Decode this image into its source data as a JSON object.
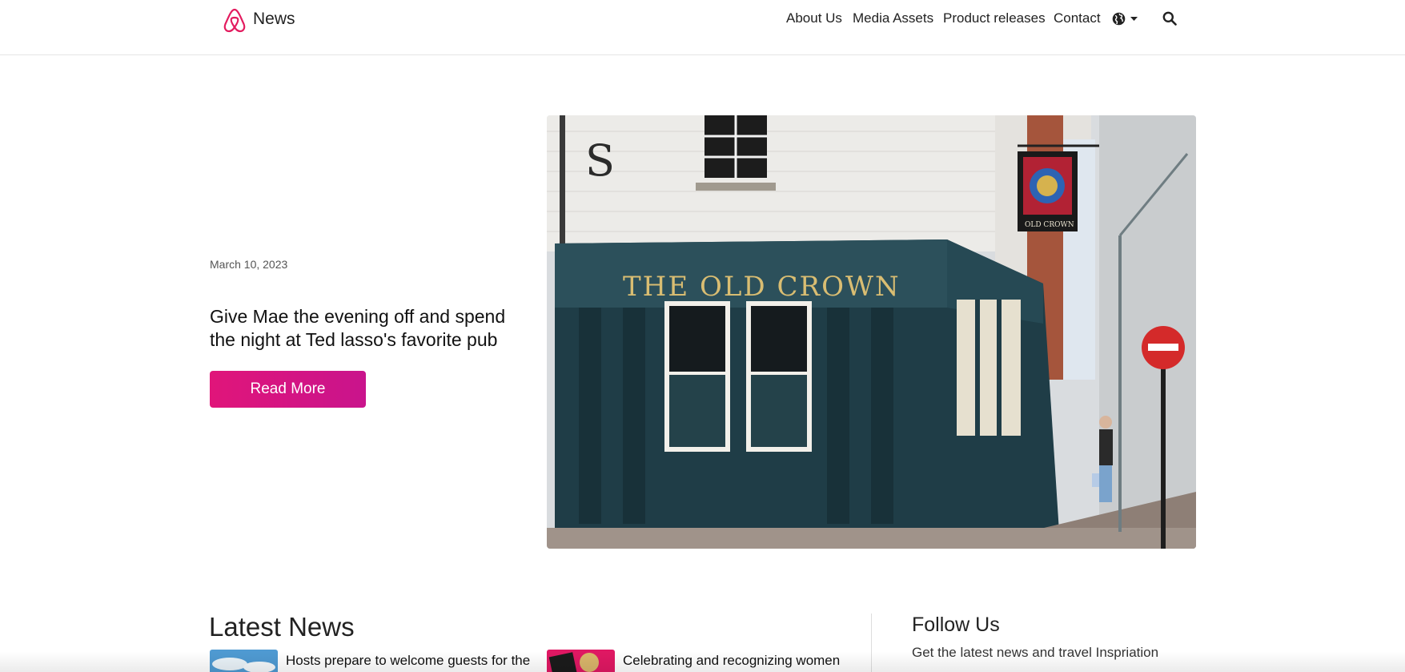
{
  "header": {
    "brand_text": "News",
    "nav": {
      "about": "About Us",
      "media": "Media Assets",
      "product": "Product releases",
      "contact": "Contact"
    },
    "icons": [
      "airbnb-logo-icon",
      "globe-icon",
      "caret-down-icon",
      "search-icon"
    ],
    "brand_color": "#e31c5f"
  },
  "hero": {
    "date": "March 10, 2023",
    "title": "Give Mae the evening off and spend the night at Ted lasso's favorite pub",
    "button_label": "Read More",
    "button_color": "#d8157f",
    "image_sign_text": "THE OLD CROWN",
    "image_hanging_sign_text": "OLD CROWN"
  },
  "latest": {
    "heading": "Latest News",
    "items": [
      {
        "title": "Hosts prepare to welcome guests for the"
      },
      {
        "title": "Celebrating and recognizing women"
      }
    ]
  },
  "follow": {
    "heading": "Follow Us",
    "subtitle": "Get the latest news and travel Inspriation"
  }
}
